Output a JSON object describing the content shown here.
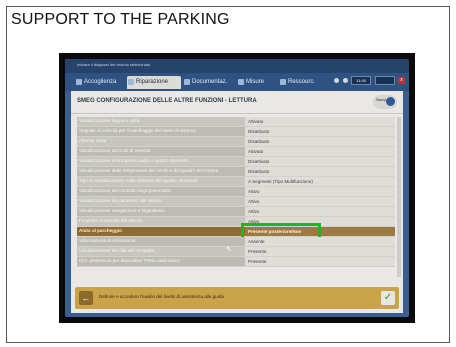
{
  "heading": "SUPPORT TO THE PARKING",
  "app": {
    "window_title": "Iniziare il diagnosi del veicolo selezionato",
    "tabs": [
      {
        "label": "Accoglienza",
        "icon": "home-icon",
        "active": false
      },
      {
        "label": "Riparazione",
        "icon": "wrench-icon",
        "active": true
      },
      {
        "label": "Documentaz.",
        "icon": "book-icon",
        "active": false
      },
      {
        "label": "Misure",
        "icon": "gauge-icon",
        "active": false
      },
      {
        "label": "Ressourc.",
        "icon": "folder-icon",
        "active": false
      }
    ],
    "status": {
      "time": "11:00",
      "box1": "",
      "close": "x"
    }
  },
  "panel": {
    "title": "SMEG  CONFIGURAZIONE DELLE ALTRE FUNZIONI - LETTURA",
    "chip_label": "Stampa"
  },
  "rows": [
    {
      "label": "Visualizzazione lingua e unità",
      "value": "Attivato"
    },
    {
      "label": "Segnale di velocità per il cambiaggio dei menù di sistema",
      "value": "Disattivato"
    },
    {
      "label": "Allarme radar",
      "value": "Disattivato"
    },
    {
      "label": "Visualizzazione dei limiti di velocità",
      "value": "Attivato"
    },
    {
      "label": "Visualizzazione informazioni audio e quadro strumenti",
      "value": "Disattivato"
    },
    {
      "label": "Visualizzazione delle temperature dei cerchi e del quadro del motore",
      "value": "Disattivato"
    },
    {
      "label": "Tipo di visualizzazione sullo schermo del quadro strumenti",
      "value": "A Segmenti (Tipo Multifunzione)"
    },
    {
      "label": "Visualizzazione del controllo degli pneumatici",
      "value": "Attivo"
    },
    {
      "label": "Visualizzazione dei parametri del veicolo",
      "value": "Attivo"
    },
    {
      "label": "Visualizzazione navigazione e segnaletica",
      "value": "Attivo"
    },
    {
      "label": "Funzione di servizio del veicolo",
      "value": "Attivo"
    },
    {
      "label": "Aiuto al parcheggio",
      "value": "Presente posteriore/Non",
      "selected": true
    },
    {
      "label": "Videocamera di retromarcia",
      "value": "Assente"
    },
    {
      "label": "Visualizzazione dei dati del computer",
      "value": "Presente"
    },
    {
      "label": "ISO: preferenza per dispositivo TPMS automatico",
      "value": "Presente"
    }
  ],
  "footer": {
    "message": "Definire e accedere l'ausilio del livello di assistenza alla guida",
    "back_icon": "arrow-left-icon",
    "ok_icon": "check-icon"
  },
  "colors": {
    "highlight": "#1fb61f",
    "selected_row": "#8f6b33",
    "screen_bg": "#3a5f8e",
    "footer_bg": "#caa24a"
  }
}
